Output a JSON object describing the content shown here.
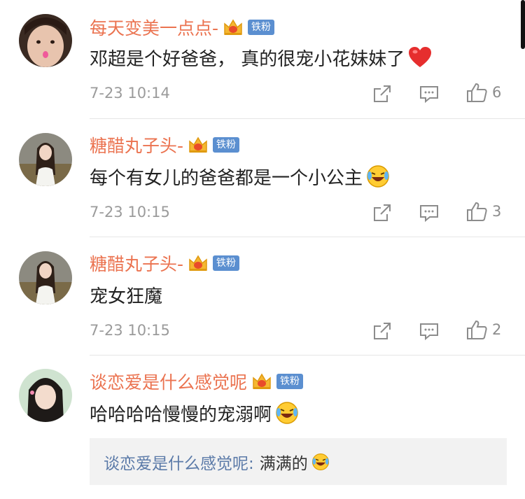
{
  "comments": [
    {
      "username": "每天变美一点点-",
      "fan_badge": "铁粉",
      "text": "邓超是个好爸爸， 真的很宠小花妹妹了",
      "emoji": "heart-emoji",
      "time": "7-23 10:14",
      "likes": "6"
    },
    {
      "username": "糖醋丸子头-",
      "fan_badge": "铁粉",
      "text": "每个有女儿的爸爸都是一个小公主",
      "emoji": "laugh-cry-emoji",
      "time": "7-23 10:15",
      "likes": "3"
    },
    {
      "username": "糖醋丸子头-",
      "fan_badge": "铁粉",
      "text": "宠女狂魔",
      "emoji": "",
      "time": "7-23 10:15",
      "likes": "2"
    },
    {
      "username": "谈恋爱是什么感觉呢",
      "fan_badge": "铁粉",
      "text": "哈哈哈哈慢慢的宠溺啊",
      "emoji": "laugh-cry-emoji",
      "reply": {
        "name": "谈恋爱是什么感觉呢:",
        "text": "满满的",
        "emoji": "laugh-cry-emoji"
      }
    }
  ],
  "colors": {
    "username": "#eb7350",
    "fan_badge_bg": "#5b8fd0",
    "reply_name": "#5b7aa8",
    "meta": "#9b9b9b",
    "divider": "#e6e6e6"
  },
  "icons": [
    "share-icon",
    "comment-icon",
    "like-icon",
    "crown-icon"
  ]
}
